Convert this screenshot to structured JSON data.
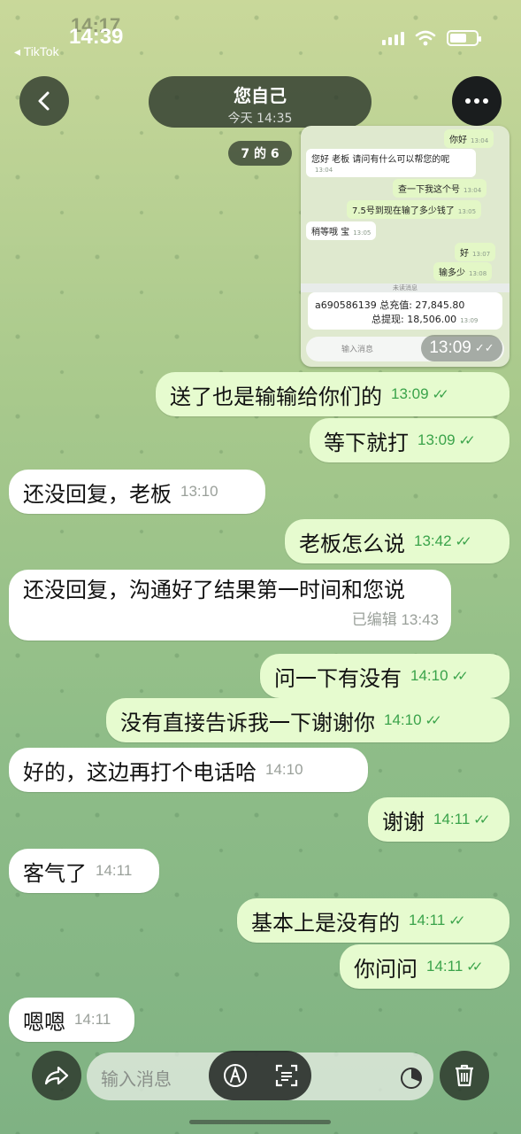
{
  "status_bar": {
    "time": "14:39",
    "ghost_time": "14:17",
    "back_app": "◂ TikTok"
  },
  "header": {
    "title": "您自己",
    "subtitle": "今天 14:35"
  },
  "counter": "7 的 6",
  "embedded": {
    "m1": {
      "text": "你好",
      "time": "13:04"
    },
    "m2": {
      "text": "您好 老板 请问有什么可以帮您的呢",
      "time": "13:04"
    },
    "m3": {
      "text": "查一下我这个号",
      "time": "13:04"
    },
    "m4": {
      "text": "7.5号到现在输了多少钱了",
      "time": "13:05"
    },
    "m5": {
      "text": "稍等哦 宝",
      "time": "13:05"
    },
    "m6": {
      "text": "好",
      "time": "13:07"
    },
    "m7": {
      "text": "输多少",
      "time": "13:08"
    },
    "divider": "未读消息",
    "card_line1": "a690586139  总充值:  27,845.80",
    "card_line2": "总提现:  18,506.00",
    "card_time": "13:09",
    "input_placeholder": "输入消息",
    "stamp": "13:09"
  },
  "messages": [
    {
      "text": "送了也是输输给你们的",
      "time": "13:09"
    },
    {
      "text": "等下就打",
      "time": "13:09"
    },
    {
      "text": "还没回复，老板",
      "time": "13:10"
    },
    {
      "text": "老板怎么说",
      "time": "13:42"
    },
    {
      "text": "还没回复，沟通好了结果第一时间和您说",
      "meta": "已编辑 13:43"
    },
    {
      "text": "问一下有没有",
      "time": "14:10"
    },
    {
      "text": "没有直接告诉我一下谢谢你",
      "time": "14:10"
    },
    {
      "text": "好的，这边再打个电话哈",
      "time": "14:10"
    },
    {
      "text": "谢谢",
      "time": "14:11"
    },
    {
      "text": "客气了",
      "time": "14:11"
    },
    {
      "text": "基本上是没有的",
      "time": "14:11"
    },
    {
      "text": "你问问",
      "time": "14:11"
    },
    {
      "text": "嗯嗯",
      "time": "14:11"
    }
  ],
  "input": {
    "placeholder": "输入消息"
  },
  "colors": {
    "outgoing_bubble": "#e6fbcf",
    "incoming_bubble": "#ffffff",
    "read_check": "#3aa34a"
  },
  "icons": [
    "back-chevron-icon",
    "more-dots-icon",
    "share-icon",
    "pen-icon",
    "scan-icon",
    "pie-timer-icon",
    "trash-icon",
    "read-check-icon"
  ]
}
